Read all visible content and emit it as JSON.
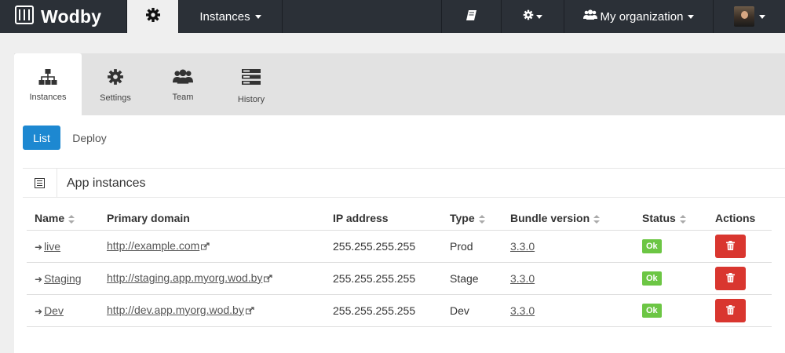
{
  "navbar": {
    "brand": "Wodby",
    "instances_menu": "Instances",
    "org_menu": "My organization",
    "icons": {
      "logo": "box-icon",
      "settings": "gear-icon",
      "docs": "book-icon",
      "org": "users-icon"
    }
  },
  "tabs": [
    {
      "label": "Instances",
      "icon": "sitemap-icon",
      "active": true
    },
    {
      "label": "Settings",
      "icon": "gear-icon",
      "active": false
    },
    {
      "label": "Team",
      "icon": "users-icon",
      "active": false
    },
    {
      "label": "History",
      "icon": "server-icon",
      "active": false
    }
  ],
  "subnav": {
    "list": "List",
    "deploy": "Deploy"
  },
  "panel": {
    "title": "App instances"
  },
  "table": {
    "headers": {
      "name": "Name",
      "domain": "Primary domain",
      "ip": "IP address",
      "type": "Type",
      "bundle": "Bundle version",
      "status": "Status",
      "actions": "Actions"
    },
    "rows": [
      {
        "name": "live",
        "domain": "http://example.com",
        "ip": "255.255.255.255",
        "type": "Prod",
        "bundle": "3.3.0",
        "status": "Ok"
      },
      {
        "name": "Staging",
        "domain": "http://staging.app.myorg.wod.by",
        "ip": "255.255.255.255",
        "type": "Stage",
        "bundle": "3.3.0",
        "status": "Ok"
      },
      {
        "name": "Dev",
        "domain": "http://dev.app.myorg.wod.by",
        "ip": "255.255.255.255",
        "type": "Dev",
        "bundle": "3.3.0",
        "status": "Ok"
      }
    ]
  },
  "colors": {
    "navbar": "#2b3037",
    "primary": "#1d88d1",
    "success": "#6cc644",
    "danger": "#d9362f"
  }
}
